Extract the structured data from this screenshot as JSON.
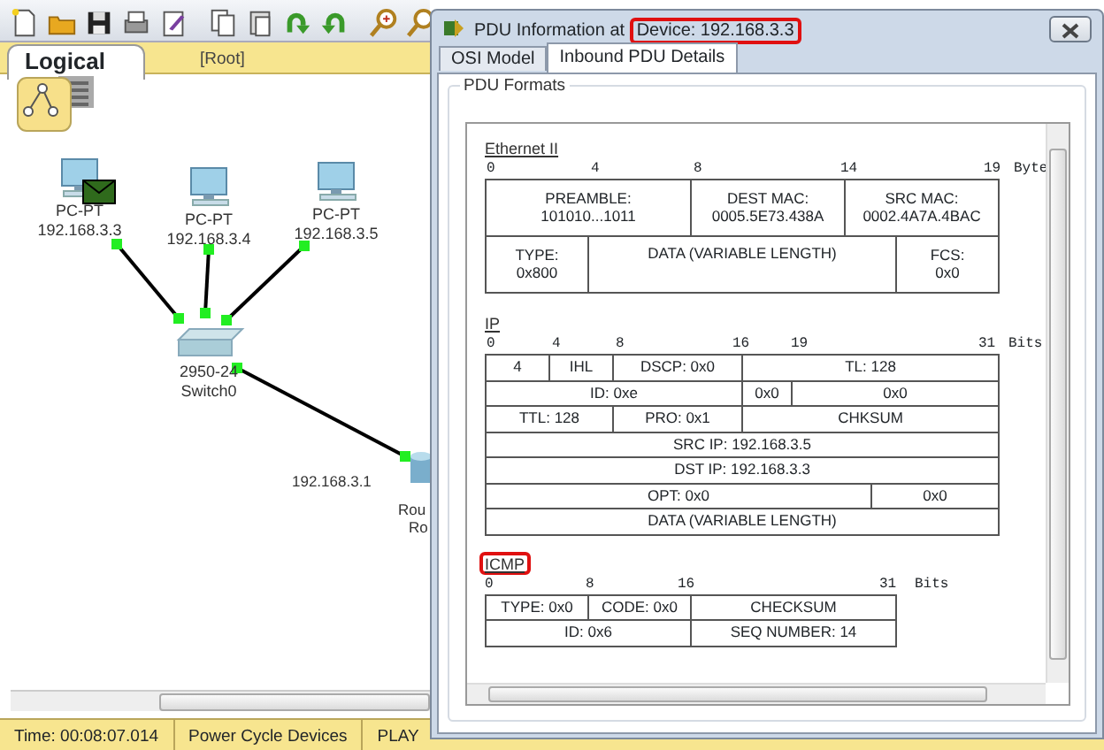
{
  "workspace": {
    "tab": "Logical",
    "path": "[Root]"
  },
  "topology": {
    "nodes": [
      {
        "kind": "pc",
        "model": "PC-PT",
        "address": "192.168.3.3",
        "has_pdu": true
      },
      {
        "kind": "pc",
        "model": "PC-PT",
        "address": "192.168.3.4",
        "has_pdu": false
      },
      {
        "kind": "pc",
        "model": "PC-PT",
        "address": "192.168.3.5",
        "has_pdu": false
      },
      {
        "kind": "switch",
        "model": "2950-24",
        "address": "Switch0",
        "has_pdu": false
      },
      {
        "kind": "router",
        "model": "Rou",
        "address": "Ro",
        "has_pdu": false
      }
    ],
    "interface_label": "192.168.3.1"
  },
  "status_bar": [
    "Time: 00:08:07.014",
    "Power Cycle Devices",
    "PLAY"
  ],
  "dialog": {
    "title": "PDU Information at ",
    "device": "Device: 192.168.3.3",
    "device_highlighted": true,
    "tabs": [
      {
        "label": "OSI Model",
        "selected": false
      },
      {
        "label": "Inbound PDU Details",
        "selected": true
      }
    ],
    "group": "PDU Formats",
    "sections": [
      {
        "title": "Ethernet II",
        "highlighted": false,
        "ticks": [
          "0",
          "4",
          "8",
          "14",
          "19"
        ],
        "unit": "Byte",
        "field_rows": [
          {
            "fields": [
              {
                "lines": [
                  "PREAMBLE:",
                  "101010...1011"
                ]
              },
              {
                "lines": [
                  "DEST MAC:",
                  "0005.5E73.438A"
                ]
              },
              {
                "lines": [
                  "SRC MAC:",
                  "0002.4A7A.4BAC"
                ]
              }
            ]
          },
          {
            "fields": [
              {
                "lines": [
                  "TYPE:",
                  "0x800"
                ]
              },
              {
                "lines": [
                  "DATA (VARIABLE LENGTH)"
                ]
              },
              {
                "lines": [
                  "FCS:",
                  "0x0"
                ]
              }
            ]
          }
        ]
      },
      {
        "title": "IP",
        "highlighted": false,
        "ticks": [
          "0",
          "4",
          "8",
          "16",
          "19",
          "31"
        ],
        "unit": "Bits",
        "field_rows": [
          {
            "fields": [
              {
                "lines": [
                  "4"
                ]
              },
              {
                "lines": [
                  "IHL"
                ]
              },
              {
                "lines": [
                  "DSCP: 0x0"
                ]
              },
              {
                "lines": [
                  "TL: 128"
                ]
              }
            ]
          },
          {
            "fields": [
              {
                "lines": [
                  "ID: 0xe"
                ]
              },
              {
                "lines": [
                  "0x0"
                ]
              },
              {
                "lines": [
                  "0x0"
                ]
              }
            ]
          },
          {
            "fields": [
              {
                "lines": [
                  "TTL: 128"
                ]
              },
              {
                "lines": [
                  "PRO: 0x1"
                ]
              },
              {
                "lines": [
                  "CHKSUM"
                ]
              }
            ]
          },
          {
            "fields": [
              {
                "lines": [
                  "SRC IP: 192.168.3.5"
                ]
              }
            ]
          },
          {
            "fields": [
              {
                "lines": [
                  "DST IP: 192.168.3.3"
                ]
              }
            ]
          },
          {
            "fields": [
              {
                "lines": [
                  "OPT: 0x0"
                ]
              },
              {
                "lines": [
                  "0x0"
                ]
              }
            ]
          },
          {
            "fields": [
              {
                "lines": [
                  "DATA (VARIABLE LENGTH)"
                ]
              }
            ]
          }
        ]
      },
      {
        "title": "ICMP",
        "highlighted": true,
        "ticks": [
          "0",
          "8",
          "16",
          "31"
        ],
        "unit": "Bits",
        "field_rows": [
          {
            "fields": [
              {
                "lines": [
                  "TYPE: 0x0"
                ]
              },
              {
                "lines": [
                  "CODE: 0x0"
                ]
              },
              {
                "lines": [
                  "CHECKSUM"
                ]
              }
            ]
          },
          {
            "fields": [
              {
                "lines": [
                  "ID: 0x6"
                ]
              },
              {
                "lines": [
                  "SEQ NUMBER: 14"
                ]
              }
            ]
          }
        ]
      }
    ]
  }
}
